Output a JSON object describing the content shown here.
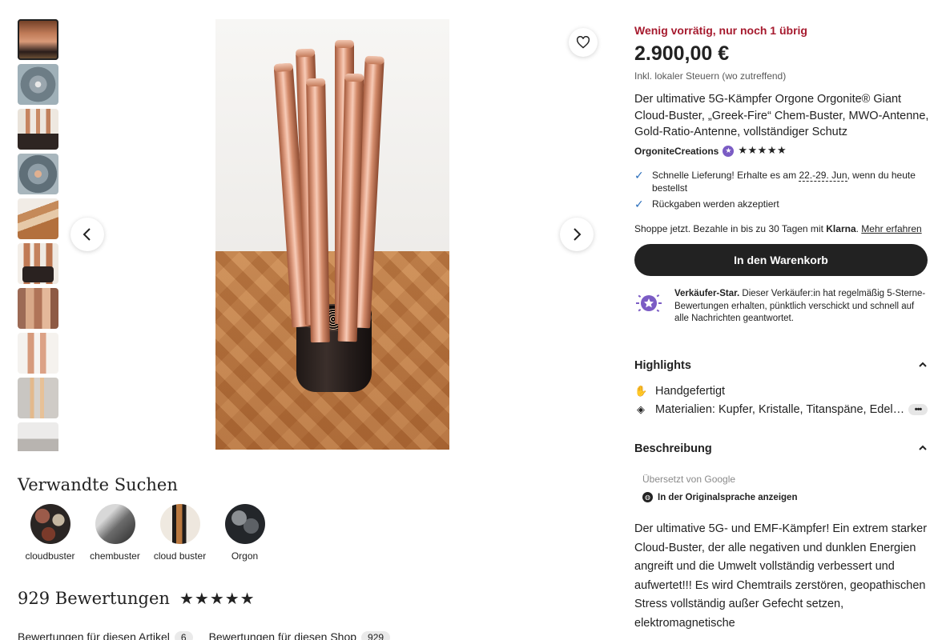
{
  "gallery": {
    "thumbnails": [
      "thumbnail-1",
      "thumbnail-2",
      "thumbnail-3",
      "thumbnail-4",
      "thumbnail-5",
      "thumbnail-6",
      "thumbnail-7",
      "thumbnail-8",
      "thumbnail-9",
      "thumbnail-10"
    ],
    "prev_icon": "chevron-left-icon",
    "next_icon": "chevron-right-icon",
    "favorite_icon": "heart-icon"
  },
  "related": {
    "title": "Verwandte Suchen",
    "items": [
      {
        "label": "cloudbuster"
      },
      {
        "label": "chembuster"
      },
      {
        "label": "cloud buster"
      },
      {
        "label": "Orgon"
      }
    ]
  },
  "reviews": {
    "title": "929 Bewertungen",
    "stars": "★★★★★",
    "tab_item": "Bewertungen für diesen Artikel",
    "tab_item_count": "6",
    "tab_shop": "Bewertungen für diesen Shop",
    "tab_shop_count": "929"
  },
  "product": {
    "low_stock": "Wenig vorrätig, nur noch 1 übrig",
    "price": "2.900,00 €",
    "tax_note": "Inkl. lokaler Steuern (wo zutreffend)",
    "title": "Der ultimative 5G-Kämpfer Orgone Orgonite® Giant Cloud-Buster, „Greek-Fire“ Chem-Buster, MWO-Antenne, Gold-Ratio-Antenne, vollständiger Schutz",
    "shop_name": "OrgoniteCreations",
    "shop_stars": "★★★★★",
    "benefits": {
      "delivery_prefix": "Schnelle Lieferung! Erhalte es am ",
      "delivery_dates": "22.-29. Jun",
      "delivery_suffix": ", wenn du heute bestellst",
      "returns": "Rückgaben werden akzeptiert"
    },
    "klarna": {
      "prefix": "Shoppe jetzt. Bezahle in bis zu 30 Tagen mit ",
      "brand": "Klarna",
      "link": "Mehr erfahren"
    },
    "cart_button": "In den Warenkorb",
    "star_seller": {
      "bold": "Verkäufer-Star.",
      "text": " Dieser Verkäufer:in hat regelmäßig 5-Sterne-Bewertungen erhalten, pünktlich verschickt und schnell auf alle Nachrichten geantwortet."
    }
  },
  "highlights": {
    "title": "Highlights",
    "items": [
      {
        "icon": "hand-icon",
        "text": "Handgefertigt"
      },
      {
        "icon": "layers-icon",
        "text": "Materialien: Kupfer, Kristalle, Titanspäne, Edel…"
      }
    ]
  },
  "description": {
    "title": "Beschreibung",
    "translated_by": "Übersetzt von Google",
    "original_language": "In der Originalsprache anzeigen",
    "text": "Der ultimative 5G- und EMF-Kämpfer! Ein extrem starker Cloud-Buster, der alle negativen und dunklen Energien angreift und die Umwelt vollständig verbessert und aufwertet!!! Es wird Chemtrails zerstören, geopathischen Stress vollständig außer Gefecht setzen, elektromagnetische"
  },
  "colors": {
    "low_stock": "#a61a2e",
    "button": "#222222",
    "check": "#2a6ebb",
    "star_seller": "#7b5cc4"
  }
}
